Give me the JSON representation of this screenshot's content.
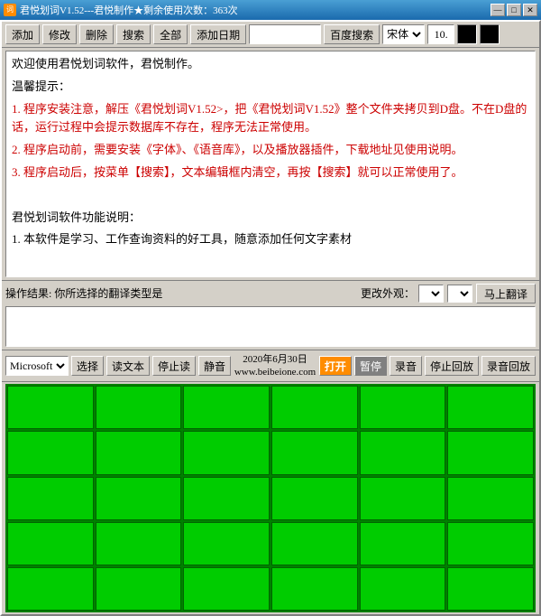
{
  "titleBar": {
    "title": "君悦划词V1.52---君悦制作★剩余使用次数：363次",
    "minBtn": "—",
    "maxBtn": "□",
    "closeBtn": "✕"
  },
  "toolbar": {
    "addBtn": "添加",
    "editBtn": "修改",
    "deleteBtn": "删除",
    "searchBtn": "搜索",
    "allBtn": "全部",
    "addDateBtn": "添加日期",
    "searchInput": "",
    "baiduBtn": "百度搜索",
    "fontSelect": "宋体",
    "sizeInput": "10.",
    "color1": "#000000",
    "color2": "#000000"
  },
  "mainText": {
    "line1": "欢迎使用君悦划词软件，君悦制作。",
    "line2": "温馨提示：",
    "item1": "1. 程序安装注意，解压《君悦划词V1.52>，把《君悦划词V1.52》整个文件夹拷贝到D盘。不在D盘的话，运行过程中会提示数据库不存在，程序无法正常使用。",
    "item2": "2. 程序启动前，需要安装《字体》、《语音库》，以及播放器插件，下载地址见使用说明。",
    "item3": "3. 程序启动后，按菜单【搜索】，文本编辑框内清空，再按【搜索】就可以正常使用了。",
    "line3": "",
    "line4": "君悦划词软件功能说明：",
    "line5": "1. 本软件是学习、工作查询资料的好工具，随意添加任何文字素材"
  },
  "statusBar": {
    "statusText": "操作结果: 你所选择的翻译类型是",
    "changeStyle": "更改外观：",
    "translateBtn": "马上翻译"
  },
  "bottomBar": {
    "voiceSelect": "Microsoft",
    "selectBtn": "选择",
    "readBtn": "读文本",
    "stopReadBtn": "停止读",
    "muteBtn": "静音",
    "dateInfo": "2020年6月30日",
    "siteInfo": "www.beibeione.com",
    "openBtn": "打开",
    "pauseBtn": "暂停",
    "recordBtn": "录音",
    "stopRecordBtn": "停止回放",
    "playRecordBtn": "录音回放"
  },
  "grid": {
    "rows": 5,
    "cols": 6
  }
}
